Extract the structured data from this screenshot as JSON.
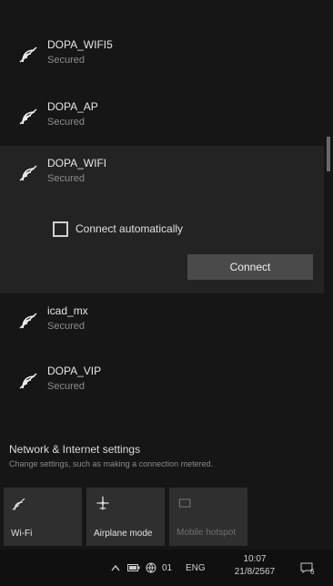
{
  "networks": [
    {
      "name": "DOPA_WIFI5",
      "status": "Secured"
    },
    {
      "name": "DOPA_AP",
      "status": "Secured"
    },
    {
      "name": "DOPA_WIFI",
      "status": "Secured"
    },
    {
      "name": "icad_mx",
      "status": "Secured"
    },
    {
      "name": "DOPA_VIP",
      "status": "Secured"
    }
  ],
  "selected_network": {
    "auto_label": "Connect automatically",
    "auto_checked": false,
    "connect_label": "Connect"
  },
  "settings": {
    "title": "Network & Internet settings",
    "subtitle": "Change settings, such as making a connection metered."
  },
  "quick_actions": [
    {
      "label": "Wi-Fi",
      "icon": "wifi-icon"
    },
    {
      "label": "Airplane mode",
      "icon": "airplane-icon"
    },
    {
      "label": "Mobile hotspot",
      "icon": "hotspot-icon"
    }
  ],
  "taskbar": {
    "language": "ENG",
    "time": "10:07",
    "date": "21/8/2567",
    "notification_count": "6",
    "volume_label": "01"
  },
  "colors": {
    "background": "#161616",
    "selected": "#232323",
    "tile": "#2f2f2f",
    "button": "#4a4a4a"
  }
}
